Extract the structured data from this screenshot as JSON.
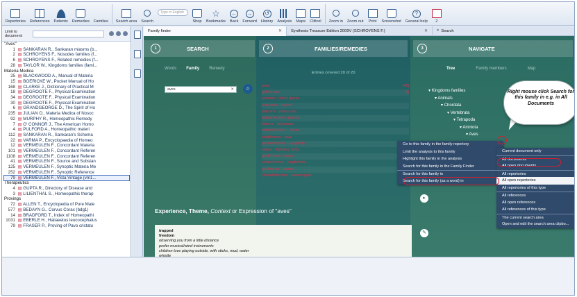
{
  "toolbar": {
    "items": [
      {
        "label": "Repertories",
        "icon": "doc-icon"
      },
      {
        "label": "References",
        "icon": "book-icon"
      },
      {
        "label": "Patients",
        "icon": "person-icon"
      },
      {
        "label": "Remedies",
        "icon": "jar-icon"
      },
      {
        "label": "Families",
        "icon": "tree-icon"
      },
      {
        "label": "Search area",
        "icon": "search-area-icon"
      },
      {
        "label": "Search",
        "icon": "search-icon"
      },
      {
        "label": "Shop",
        "icon": "shop-icon"
      },
      {
        "label": "Bookmarks",
        "icon": "star-icon"
      },
      {
        "label": "Back",
        "icon": "back-icon"
      },
      {
        "label": "Forward",
        "icon": "forward-icon"
      },
      {
        "label": "History",
        "icon": "history-icon"
      },
      {
        "label": "Analysis",
        "icon": "analysis-icon"
      },
      {
        "label": "Maps",
        "icon": "maps-icon"
      },
      {
        "label": "Clificol",
        "icon": "clificol-icon"
      },
      {
        "label": "Zoom in",
        "icon": "zoom-in-icon"
      },
      {
        "label": "Zoom out",
        "icon": "zoom-out-icon"
      },
      {
        "label": "Print",
        "icon": "print-icon"
      },
      {
        "label": "Screenshot",
        "icon": "screenshot-icon"
      },
      {
        "label": "General help",
        "icon": "help-icon"
      },
      {
        "label": "2",
        "icon": "grid-icon"
      }
    ],
    "search_placeholder": "Type in English"
  },
  "left": {
    "limit_label": "Limit to document:",
    "sections": [
      {
        "title": "\"Aves\"",
        "rows": [
          {
            "n": "1",
            "t": "SANKARAN R., Sankaran miasms (b..."
          },
          {
            "n": "2",
            "t": "SCHROYENS F., Nosodes families (f..."
          },
          {
            "n": "6",
            "t": "SCHROYENS F., Related remedies (f..."
          },
          {
            "n": "28",
            "t": "TAYLOR W., Kingdoms families (faml..."
          }
        ]
      },
      {
        "title": "Materia Medica",
        "rows": [
          {
            "n": "25",
            "t": "BLACKWOOD A., Manual of Materia"
          },
          {
            "n": "15",
            "t": "BOERICKE W., Pocket Manual of Ho"
          },
          {
            "n": "168",
            "t": "CLARKE J., Dictionary of Practical M"
          },
          {
            "n": "18",
            "t": "DEGROOTE F., Physical Examination"
          },
          {
            "n": "34",
            "t": "DEGROOTE F., Physical Examination"
          },
          {
            "n": "30",
            "t": "DEGROOTE F., Physical Examination"
          },
          {
            "n": "6",
            "t": "GRANDGEORGE D., The Spirit of Ho"
          },
          {
            "n": "235",
            "t": "JULIAN O., Materia Medica of Nosoc"
          },
          {
            "n": "92",
            "t": "MURPHY R., Homeopathic Remedy"
          },
          {
            "n": "7",
            "t": "O' CONNOR J., The American Homo"
          },
          {
            "n": "4",
            "t": "PULFORD A., Homeopathic materi"
          },
          {
            "n": "112",
            "t": "SANKARAN R., Sankaran's Schema"
          },
          {
            "n": "22",
            "t": "VARMA P., Encyclopaedia of Homeo"
          },
          {
            "n": "12",
            "t": "VERMEULEN F., Concordant Materia"
          },
          {
            "n": "101",
            "t": "VERMEULEN F., Concordant Referen"
          },
          {
            "n": "1108",
            "t": "VERMEULEN F., Concordant Referen"
          },
          {
            "n": "41",
            "t": "VERMEULEN F., Source and Substan"
          },
          {
            "n": "125",
            "t": "VERMEULEN F., Synoptic Materia Me"
          },
          {
            "n": "252",
            "t": "VERMEULEN F., Synoptic Reference"
          },
          {
            "n": "79",
            "t": "VERMEULEN F., Vista Vintage (vm1..."
          }
        ]
      },
      {
        "title": "Therapeutics",
        "rows": [
          {
            "n": "4",
            "t": "GUPTA R., Directory of Disease and"
          },
          {
            "n": "3",
            "t": "LILIENTHAL S., Homeopathic therap"
          }
        ]
      },
      {
        "title": "Provings",
        "rows": [
          {
            "n": "72",
            "t": "ALLEN T., Encyclopedia of Pure Mate"
          },
          {
            "n": "577",
            "t": "BEDAYN G., Corvus Corax (bdg1)"
          },
          {
            "n": "14",
            "t": "BRADFORD T., Index of Homeopathi"
          },
          {
            "n": "1031",
            "t": "EBERLE H., Haliaeetus leucocephalus"
          },
          {
            "n": "79",
            "t": "FRASER P., Proving of Pavo cristatu"
          }
        ]
      }
    ]
  },
  "tabs": [
    {
      "label": "Family finder"
    },
    {
      "label": "Synthesis Treasure Edition 2009V (SCHROYENS F.)"
    },
    {
      "label": "Search"
    }
  ],
  "steps": {
    "search": {
      "num": "1",
      "label": "SEARCH",
      "subtabs": [
        "Words",
        "Family",
        "Remedy"
      ]
    },
    "families": {
      "num": "2",
      "label": "FAMILIES/REMEDIES",
      "entries": "Entries covered 20 of 20"
    },
    "navigate": {
      "num": "3",
      "label": "NAVIGATE",
      "subtabs": [
        "Tree",
        "Family members",
        "Map"
      ]
    }
  },
  "search_field": {
    "value": "aves"
  },
  "family_list": [
    {
      "name": "aves",
      "count": "[45]"
    },
    {
      "name": "galliformes",
      "count": "[4]"
    },
    {
      "name": "anseres - ducks geese",
      "count": ""
    },
    {
      "name": "accipitres - raptors",
      "count": ""
    },
    {
      "name": "pelicans - pelican etc",
      "count": ""
    },
    {
      "name": "psittaciformes - parrots",
      "count": ""
    },
    {
      "name": "falcons - falconidae",
      "count": ""
    },
    {
      "name": "columbiformes - doves",
      "count": ""
    },
    {
      "name": "strigiformes - owls",
      "count": ""
    },
    {
      "name": "passeriformes - songbirds",
      "count": ""
    },
    {
      "name": "ratites - flightless birds",
      "count": ""
    },
    {
      "name": "gaviiformes - loons",
      "count": ""
    },
    {
      "name": "coraciiformes - kingfishers",
      "count": ""
    },
    {
      "name": "gruiformes - cranes",
      "count": ""
    },
    {
      "name": "charadriiformes - waders gulls",
      "count": ""
    }
  ],
  "tree": [
    {
      "label": "Kingdoms families",
      "indent": 0
    },
    {
      "label": "Animals",
      "indent": 1
    },
    {
      "label": "Chordata",
      "indent": 2
    },
    {
      "label": "Vertebrata",
      "indent": 3
    },
    {
      "label": "Tetrapoda",
      "indent": 4
    },
    {
      "label": "Amniota",
      "indent": 5
    },
    {
      "label": "Aves",
      "indent": 6
    }
  ],
  "experience": {
    "head1": "Experience",
    "head2": "Theme",
    "head3": "Context",
    "tail": " or Expression of \"aves\""
  },
  "text_lines": [
    {
      "t": "trapped",
      "style": "b"
    },
    {
      "t": "freedom",
      "style": "b"
    },
    {
      "t": "observing you from a little distance",
      "style": "i"
    },
    {
      "t": "prefer musical/wind instruments",
      "style": "i"
    },
    {
      "t": "children love playing outside, with sticks, mud, water",
      "style": "i"
    },
    {
      "t": "whistle",
      "style": "i"
    }
  ],
  "context_menu_1": [
    "Go to this family in the family repertory",
    "Limit the analysis to this family",
    "Highlight this family in the analysis",
    "Search for this family in the Family Finder",
    "Search for this family in",
    "Search for this family (as a word) in"
  ],
  "context_menu_2": [
    "Current document only",
    "All documents",
    "All open documents",
    "All repertories",
    "All open repertories",
    "All repertories of this type",
    "All references",
    "All open references",
    "All references of this type",
    "The current search area",
    "Open and edit the search area clipbo..."
  ],
  "callout": "Right mouse click Search for this family in e.g. in All Documents"
}
